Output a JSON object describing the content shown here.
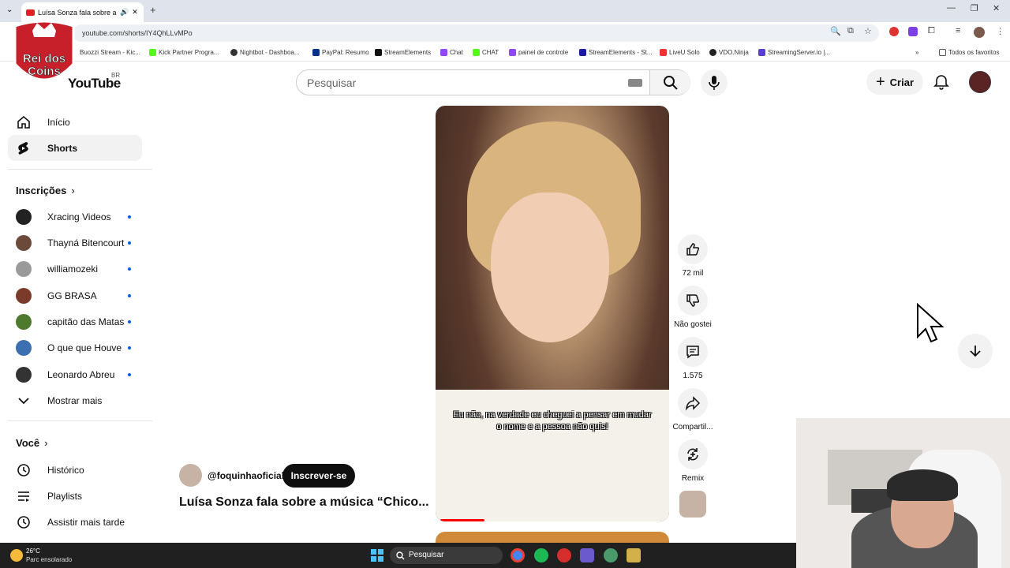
{
  "browser": {
    "tab_title": "Luísa Sonza fala sobre a m...",
    "url": "youtube.com/shorts/IY4QhLLvMPo",
    "bookmarks": [
      "Buozzi Stream - Kic...",
      "Kick Partner Progra...",
      "Nightbot - Dashboa...",
      "PayPal: Resumo",
      "StreamElements",
      "Chat",
      "CHAT",
      "painel de controle",
      "StreamElements - St...",
      "LiveU Solo",
      "VDO.Ninja",
      "StreamingServer.io |..."
    ],
    "all_bookmarks": "Todos os favoritos"
  },
  "youtube": {
    "logo": "YouTube",
    "country": "BR",
    "search_placeholder": "Pesquisar",
    "create_label": "Criar"
  },
  "sidebar": {
    "home": "Início",
    "shorts": "Shorts",
    "subscriptions_title": "Inscrições",
    "subscriptions": [
      "Xracing Videos",
      "Thayná Bitencourt",
      "williamozeki",
      "GG BRASA",
      "capitão das Matas",
      "O que que Houve",
      "Leonardo Abreu"
    ],
    "show_more": "Mostrar mais",
    "you_title": "Você",
    "history": "Histórico",
    "playlists": "Playlists",
    "watch_later": "Assistir mais tarde"
  },
  "short": {
    "subtitle": "Eu não, na verdade eu cheguei a pensar em mudar o nome e a pessoa não quis!",
    "channel": "@foquinhaoficial",
    "subscribe": "Inscrever-se",
    "title": "Luísa Sonza fala sobre a música “Chico...",
    "likes": "72 mil",
    "dislike": "Não gostei",
    "comments": "1.575",
    "share": "Compartil...",
    "remix": "Remix",
    "progress": 0.19
  },
  "overlay": {
    "logo_line1": "Rei dos",
    "logo_line2": "Coins"
  },
  "taskbar": {
    "temperature": "26°C",
    "weather": "Parc ensolarado",
    "search": "Pesquisar"
  }
}
